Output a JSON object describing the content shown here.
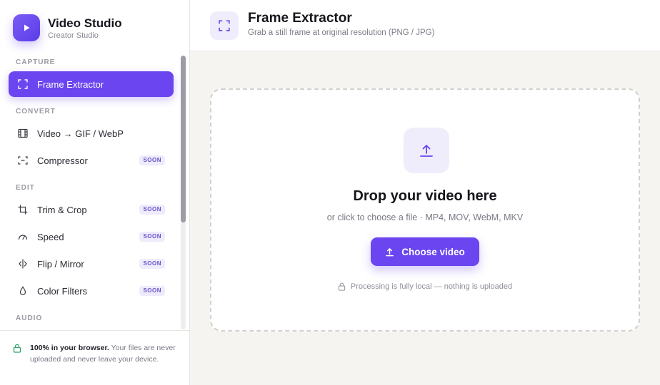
{
  "brand": {
    "title": "Video Studio",
    "subtitle": "Creator Studio"
  },
  "nav": {
    "sections": {
      "capture": "CAPTURE",
      "convert": "CONVERT",
      "edit": "EDIT",
      "audio": "AUDIO"
    },
    "items": [
      {
        "label": "Frame Extractor",
        "badge": ""
      },
      {
        "label": "Video → GIF / WebP",
        "badge": ""
      },
      {
        "label": "Compressor",
        "badge": "SOON"
      },
      {
        "label": "Trim & Crop",
        "badge": "SOON"
      },
      {
        "label": "Speed",
        "badge": "SOON"
      },
      {
        "label": "Flip / Mirror",
        "badge": "SOON"
      },
      {
        "label": "Color Filters",
        "badge": "SOON"
      }
    ]
  },
  "footer": {
    "bold": "100% in your browser.",
    "text": " Your files are never uploaded and never leave your device."
  },
  "header": {
    "title": "Frame Extractor",
    "subtitle": "Grab a still frame at original resolution (PNG / JPG)"
  },
  "dropzone": {
    "title": "Drop your video here",
    "subtitle": "or click to choose a file · MP4, MOV, WebM, MKV",
    "button": "Choose video",
    "privacy": "Processing is fully local — nothing is uploaded"
  },
  "colors": {
    "accent": "#6a45f0",
    "accent_soft": "#efecfb",
    "background": "#f5f4f1"
  }
}
